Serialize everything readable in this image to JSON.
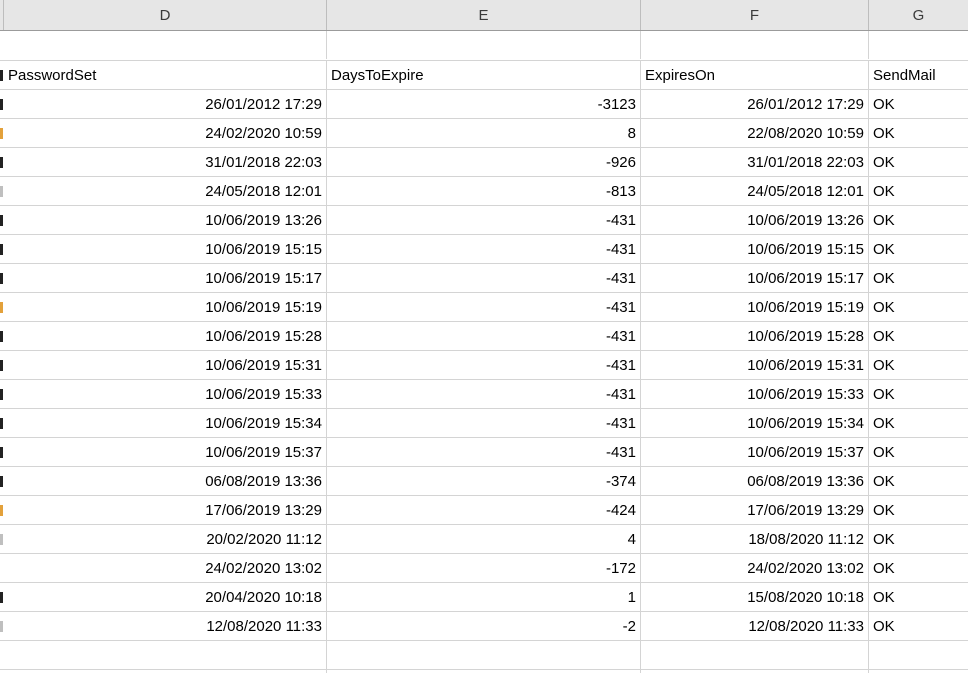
{
  "columns": {
    "d": "D",
    "e": "E",
    "f": "F",
    "g": "G"
  },
  "headers": {
    "password_set": "PasswordSet",
    "days_to_expire": "DaysToExpire",
    "expires_on": "ExpiresOn",
    "send_mail": "SendMail"
  },
  "rows": [
    {
      "password_set": "26/01/2012 17:29",
      "days_to_expire": "-3123",
      "expires_on": "26/01/2012 17:29",
      "send_mail": "OK"
    },
    {
      "password_set": "24/02/2020 10:59",
      "days_to_expire": "8",
      "expires_on": "22/08/2020 10:59",
      "send_mail": "OK"
    },
    {
      "password_set": "31/01/2018 22:03",
      "days_to_expire": "-926",
      "expires_on": "31/01/2018 22:03",
      "send_mail": "OK"
    },
    {
      "password_set": "24/05/2018 12:01",
      "days_to_expire": "-813",
      "expires_on": "24/05/2018 12:01",
      "send_mail": "OK"
    },
    {
      "password_set": "10/06/2019 13:26",
      "days_to_expire": "-431",
      "expires_on": "10/06/2019 13:26",
      "send_mail": "OK"
    },
    {
      "password_set": "10/06/2019 15:15",
      "days_to_expire": "-431",
      "expires_on": "10/06/2019 15:15",
      "send_mail": "OK"
    },
    {
      "password_set": "10/06/2019 15:17",
      "days_to_expire": "-431",
      "expires_on": "10/06/2019 15:17",
      "send_mail": "OK"
    },
    {
      "password_set": "10/06/2019 15:19",
      "days_to_expire": "-431",
      "expires_on": "10/06/2019 15:19",
      "send_mail": "OK"
    },
    {
      "password_set": "10/06/2019 15:28",
      "days_to_expire": "-431",
      "expires_on": "10/06/2019 15:28",
      "send_mail": "OK"
    },
    {
      "password_set": "10/06/2019 15:31",
      "days_to_expire": "-431",
      "expires_on": "10/06/2019 15:31",
      "send_mail": "OK"
    },
    {
      "password_set": "10/06/2019 15:33",
      "days_to_expire": "-431",
      "expires_on": "10/06/2019 15:33",
      "send_mail": "OK"
    },
    {
      "password_set": "10/06/2019 15:34",
      "days_to_expire": "-431",
      "expires_on": "10/06/2019 15:34",
      "send_mail": "OK"
    },
    {
      "password_set": "10/06/2019 15:37",
      "days_to_expire": "-431",
      "expires_on": "10/06/2019 15:37",
      "send_mail": "OK"
    },
    {
      "password_set": "06/08/2019 13:36",
      "days_to_expire": "-374",
      "expires_on": "06/08/2019 13:36",
      "send_mail": "OK"
    },
    {
      "password_set": "17/06/2019 13:29",
      "days_to_expire": "-424",
      "expires_on": "17/06/2019 13:29",
      "send_mail": "OK"
    },
    {
      "password_set": "20/02/2020 11:12",
      "days_to_expire": "4",
      "expires_on": "18/08/2020 11:12",
      "send_mail": "OK"
    },
    {
      "password_set": "24/02/2020 13:02",
      "days_to_expire": "-172",
      "expires_on": "24/02/2020 13:02",
      "send_mail": "OK"
    },
    {
      "password_set": "20/04/2020 10:18",
      "days_to_expire": "1",
      "expires_on": "15/08/2020 10:18",
      "send_mail": "OK"
    },
    {
      "password_set": "12/08/2020 11:33",
      "days_to_expire": "-2",
      "expires_on": "12/08/2020 11:33",
      "send_mail": "OK"
    }
  ]
}
